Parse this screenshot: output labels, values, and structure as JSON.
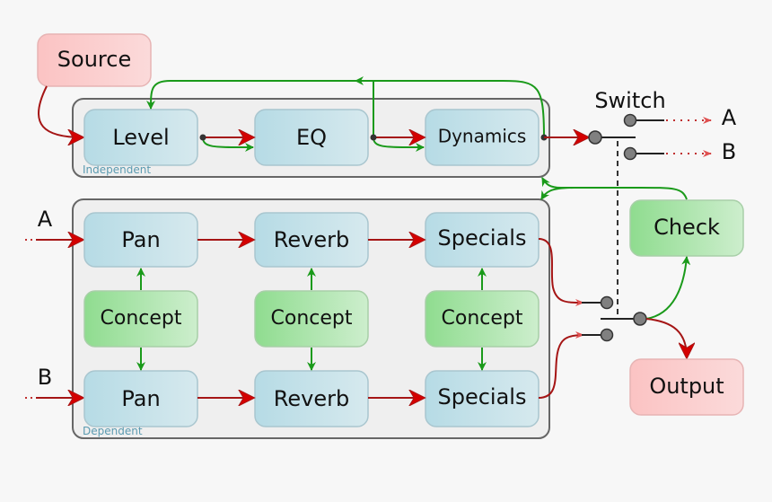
{
  "source": "Source",
  "independent": {
    "group_label": "Independent",
    "level": "Level",
    "eq": "EQ",
    "dynamics": "Dynamics"
  },
  "dependent": {
    "group_label": "Dependent",
    "inputs": [
      "A",
      "B"
    ],
    "rows": [
      [
        "Pan",
        "Reverb",
        "Specials"
      ],
      [
        "Pan",
        "Reverb",
        "Specials"
      ]
    ],
    "concept": "Concept"
  },
  "switch": {
    "label": "Switch",
    "outputs": [
      "A",
      "B"
    ]
  },
  "check": "Check",
  "output": "Output",
  "colors": {
    "flow": "#a51515",
    "control": "#1a9a1a",
    "processing": "#bfe0e8",
    "concept": "#9edc9e",
    "endpoint": "#f9c9c9"
  }
}
